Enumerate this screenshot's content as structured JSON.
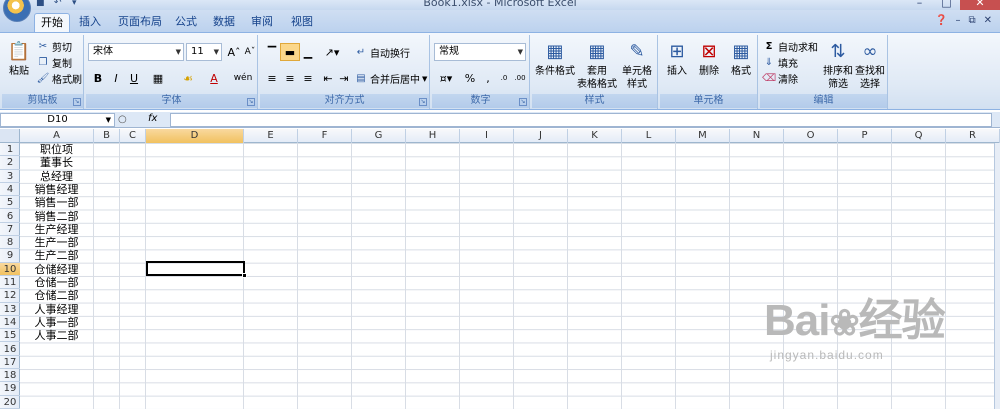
{
  "window": {
    "title": "Book1.xlsx - Microsoft Excel"
  },
  "tabs": [
    "开始",
    "插入",
    "页面布局",
    "公式",
    "数据",
    "审阅",
    "视图"
  ],
  "ribbon": {
    "clipboard": {
      "paste": "粘贴",
      "cut": "剪切",
      "copy": "复制",
      "format_painter": "格式刷",
      "label": "剪贴板"
    },
    "font": {
      "name": "宋体",
      "size": "11",
      "bold": "B",
      "italic": "I",
      "underline": "U",
      "font_color": "A",
      "phonetic": "wén",
      "label": "字体"
    },
    "alignment": {
      "wrap_text": "自动换行",
      "merge_center": "合并后居中",
      "label": "对齐方式"
    },
    "number": {
      "format": "常规",
      "percent": "%",
      "comma": ",",
      "increase_decimal": ".0→.00",
      "decrease_decimal": ".00→.0",
      "label": "数字"
    },
    "styles": {
      "conditional_formatting": "条件格式",
      "table_format_line1": "套用",
      "table_format_line2": "表格格式",
      "cell_styles_line1": "单元格",
      "cell_styles_line2": "样式",
      "label": "样式"
    },
    "cells": {
      "insert": "插入",
      "delete": "删除",
      "format": "格式",
      "label": "单元格"
    },
    "editing": {
      "autosum": "自动求和",
      "fill": "填充",
      "clear": "清除",
      "sort_filter_line1": "排序和",
      "sort_filter_line2": "筛选",
      "find_select_line1": "查找和",
      "find_select_line2": "选择",
      "label": "编辑"
    }
  },
  "formula_bar": {
    "name_box": "D10",
    "fx": "fx",
    "formula": ""
  },
  "grid": {
    "columns": [
      "A",
      "B",
      "C",
      "D",
      "E",
      "F",
      "G",
      "H",
      "I",
      "J",
      "K",
      "L",
      "M",
      "N",
      "O",
      "P",
      "Q",
      "R"
    ],
    "selected_column": "D",
    "rows": [
      "1",
      "2",
      "3",
      "4",
      "5",
      "6",
      "7",
      "8",
      "9",
      "10",
      "11",
      "12",
      "13",
      "14",
      "15",
      "16",
      "17",
      "18",
      "19",
      "20"
    ],
    "selected_row": "10",
    "column_a": [
      "职位项",
      "董事长",
      "总经理",
      "销售经理",
      "销售一部",
      "销售二部",
      "生产经理",
      "生产一部",
      "生产二部",
      "仓储经理",
      "仓储一部",
      "仓储二部",
      "人事经理",
      "人事一部",
      "人事二部"
    ]
  },
  "watermark": {
    "brand_left": "Bai",
    "brand_right": "经验",
    "url": "jingyan.baidu.com"
  }
}
